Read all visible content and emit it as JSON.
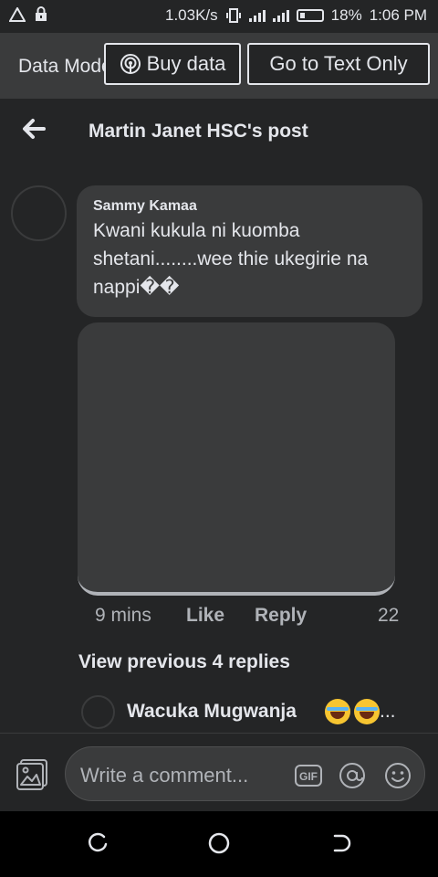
{
  "status_bar": {
    "net_speed": "1.03K/s",
    "battery_pct": "18%",
    "time": "1:06 PM",
    "icons": [
      "alert-triangle-icon",
      "lock-icon",
      "vibrate-icon",
      "signal-icon",
      "signal-icon",
      "battery-icon"
    ]
  },
  "data_bar": {
    "label": "Data Mode",
    "buy_data": "Buy data",
    "text_only": "Go to Text Only"
  },
  "header": {
    "title": "Martin Janet HSC's post"
  },
  "comment": {
    "author": "Sammy Kamaa",
    "text": "Kwani kukula ni kuomba shetani........wee thie ukegirie na nappi��",
    "time": "9 mins",
    "like": "Like",
    "reply": "Reply",
    "reaction_count": "22"
  },
  "view_previous": "View previous 4 replies",
  "reply_preview": {
    "author": "Wacuka Mugwanja",
    "emojis": [
      "face-with-tears-of-joy-icon",
      "face-with-tears-of-joy-icon"
    ],
    "ellipsis": "..."
  },
  "composer": {
    "placeholder": "Write a comment...",
    "icons": [
      "photo-icon",
      "gif-icon",
      "at-icon",
      "emoji-icon"
    ]
  },
  "nav_bar": {
    "icons": [
      "recents-icon",
      "home-icon",
      "back-icon"
    ]
  },
  "colors": {
    "background": "#242526",
    "surface": "#3a3b3c",
    "text_primary": "#e4e6eb",
    "text_secondary": "#b0b3b8"
  }
}
